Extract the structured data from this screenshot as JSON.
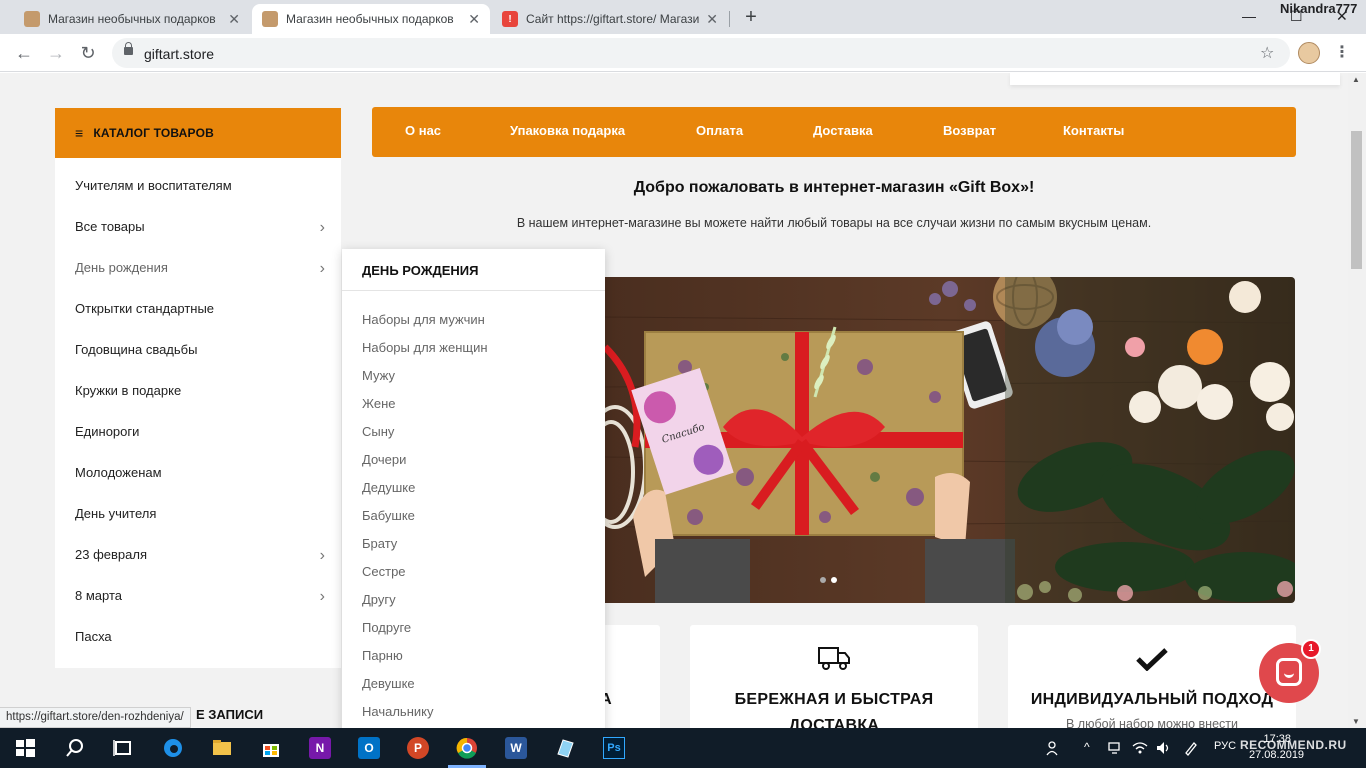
{
  "browser": {
    "tabs": [
      {
        "title": "Магазин необычных подарков",
        "close": "✕"
      },
      {
        "title": "Магазин необычных подарков",
        "close": "✕"
      },
      {
        "title": "Сайт https://giftart.store/ Магазин",
        "close": "✕"
      }
    ],
    "new_tab": "+",
    "profile": "Nikandra777",
    "url": "giftart.store",
    "back": "←",
    "forward": "→",
    "reload": "↻",
    "minimize": "—",
    "maximize": "☐",
    "close": "✕",
    "star": "☆",
    "menu": "⋮",
    "status_url": "https://giftart.store/den-rozhdeniya/"
  },
  "catalog": {
    "title": "КАТАЛОГ ТОВАРОВ",
    "burger": "≡",
    "items": [
      {
        "label": "Учителям и воспитателям",
        "chev": ""
      },
      {
        "label": "Все товары",
        "chev": "›"
      },
      {
        "label": "День рождения",
        "chev": "›"
      },
      {
        "label": "Открытки стандартные",
        "chev": ""
      },
      {
        "label": "Годовщина свадьбы",
        "chev": ""
      },
      {
        "label": "Кружки в подарке",
        "chev": ""
      },
      {
        "label": "Единороги",
        "chev": ""
      },
      {
        "label": "Молодоженам",
        "chev": ""
      },
      {
        "label": "День учителя",
        "chev": ""
      },
      {
        "label": "23 февраля",
        "chev": "›"
      },
      {
        "label": "8 марта",
        "chev": "›"
      },
      {
        "label": "Пасха",
        "chev": ""
      }
    ]
  },
  "nav": {
    "links": [
      "О нас",
      "Упаковка подарка",
      "Оплата",
      "Доставка",
      "Возврат",
      "Контакты"
    ]
  },
  "welcome": {
    "title": "Добро пожаловать в интернет-магазин «Gift Box»!",
    "text": "В нашем интернет-магазине вы можете найти любый товары на все случаи жизни по самым вкусным ценам."
  },
  "banner": {
    "card_text": "Спасибо"
  },
  "submenu": {
    "title": "ДЕНЬ РОЖДЕНИЯ",
    "items": [
      "Наборы для мужчин",
      "Наборы для женщин",
      "Мужу",
      "Жене",
      "Сыну",
      "Дочери",
      "Дедушке",
      "Бабушке",
      "Брату",
      "Сестре",
      "Другу",
      "Подруге",
      "Парню",
      "Девушке",
      "Начальнику"
    ]
  },
  "features": [
    {
      "title": "А",
      "sub": ""
    },
    {
      "title": "БЕРЕЖНАЯ И БЫСТРАЯ",
      "title2": "ДОСТАВКА",
      "sub": ""
    },
    {
      "title": "ИНДИВИДУАЛЬНЫЙ ПОДХОД",
      "sub": "В любой набор можно внести"
    }
  ],
  "recent": {
    "label": "Е ЗАПИСИ"
  },
  "chat": {
    "badge": "1"
  },
  "taskbar": {
    "lang": "РУС",
    "time": "17:38",
    "date": "27.08.2019",
    "watermark": "RECOMMEND.RU",
    "app_labels": [
      "N",
      "O",
      "P",
      "W",
      "Ps"
    ]
  },
  "colors": {
    "accent": "#e8860b",
    "chat": "#e0484c"
  }
}
